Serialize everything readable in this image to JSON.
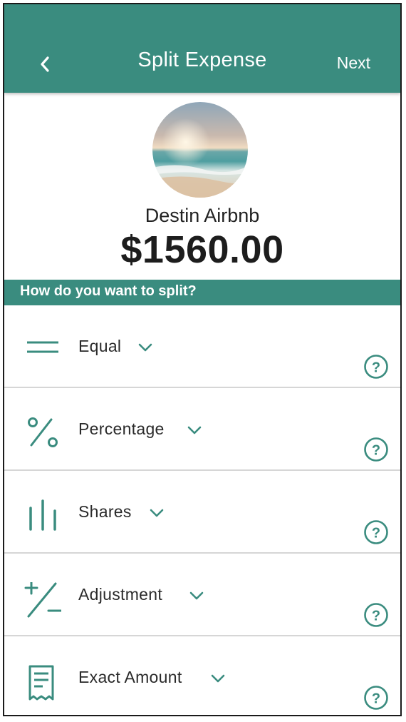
{
  "header": {
    "title": "Split Expense",
    "next_label": "Next",
    "back_icon": "chevron-left-icon"
  },
  "expense": {
    "name": "Destin Airbnb",
    "amount": "$1560.00"
  },
  "section": {
    "prompt": "How do you want to split?"
  },
  "colors": {
    "accent": "#3a8c7f",
    "divider": "#d6d6d6"
  },
  "options": [
    {
      "label": "Equal",
      "icon": "equal-lines-icon"
    },
    {
      "label": "Percentage",
      "icon": "percent-icon"
    },
    {
      "label": "Shares",
      "icon": "bars-icon"
    },
    {
      "label": "Adjustment",
      "icon": "plus-minus-icon"
    },
    {
      "label": "Exact Amount",
      "icon": "receipt-icon"
    }
  ]
}
